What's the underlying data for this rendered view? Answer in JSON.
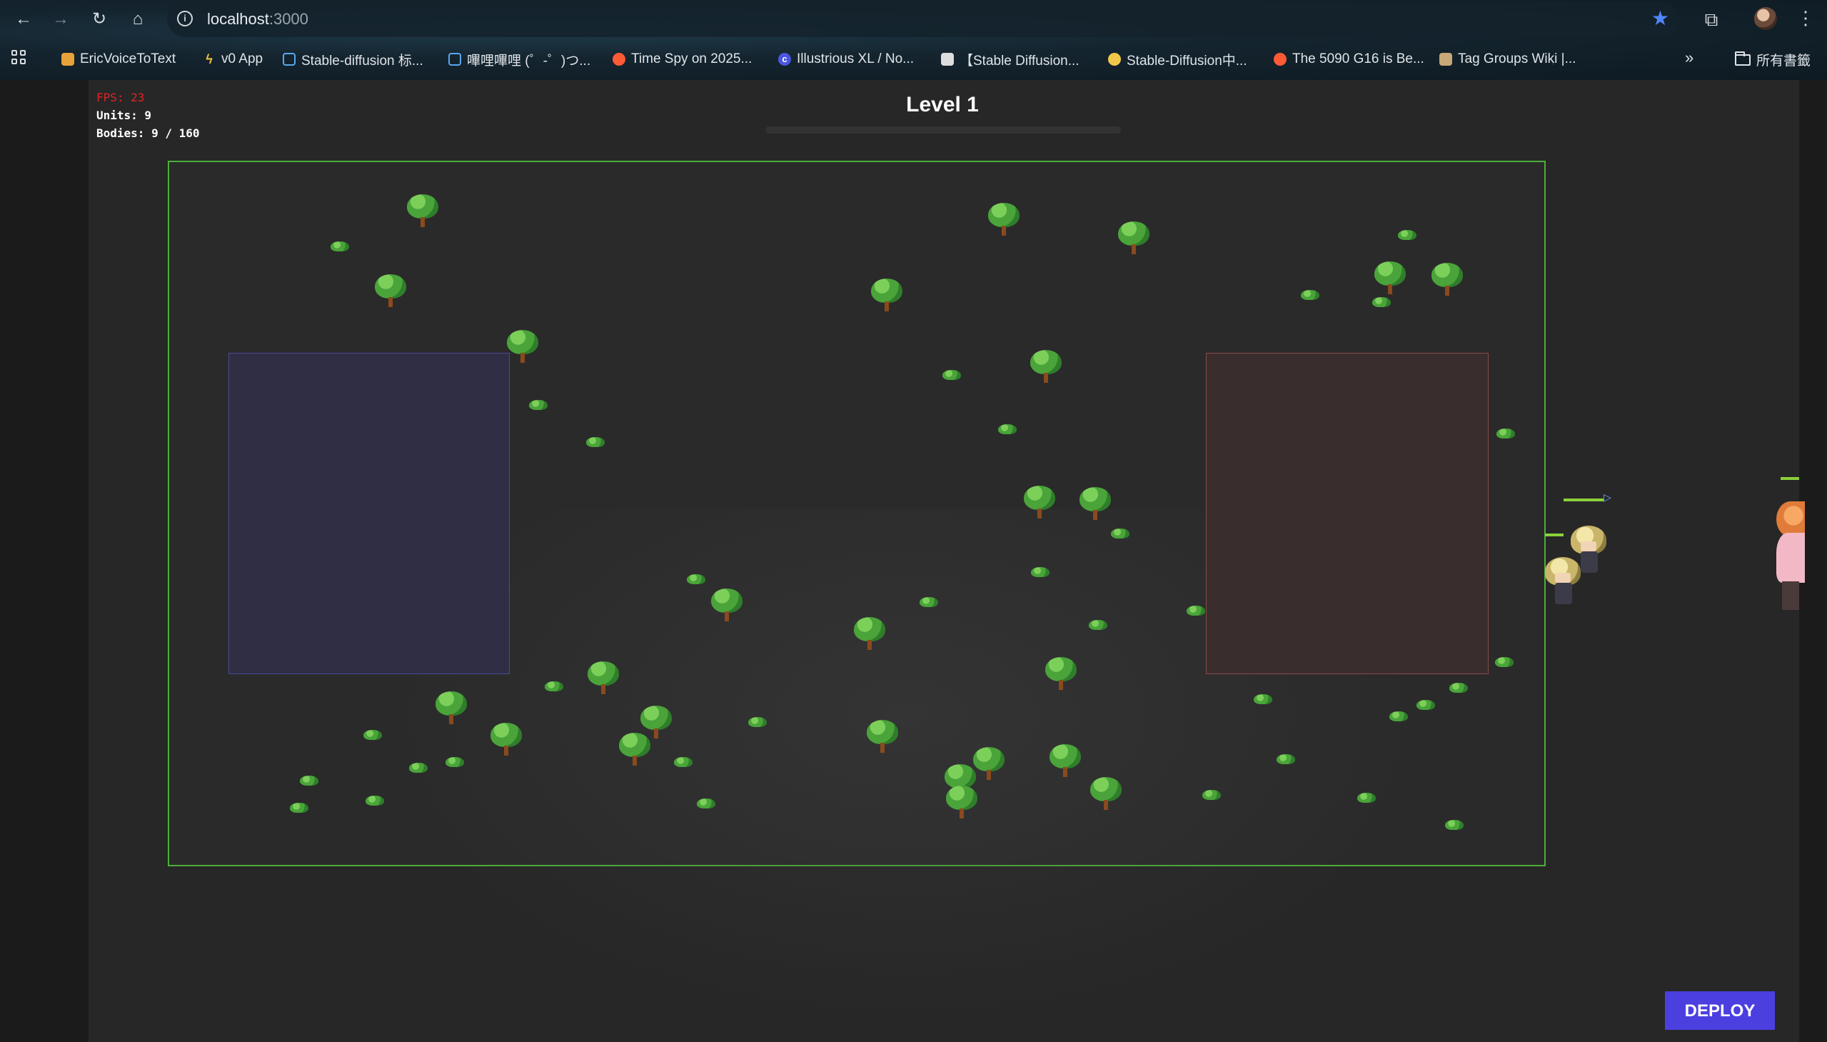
{
  "browser": {
    "url_host": "localhost",
    "url_port": ":3000",
    "bookmarks": [
      {
        "label": "EricVoiceToText",
        "icon": "layers-icon",
        "color": "#e8a23a"
      },
      {
        "label": "v0 App",
        "icon": "bolt-icon",
        "color": "#f0c040"
      },
      {
        "label": "Stable-diffusion 标...",
        "icon": "bilibili-icon",
        "color": "#5aa7f0"
      },
      {
        "label": "嗶哩嗶哩 (゜-゜)つ...",
        "icon": "bilibili-icon",
        "color": "#5aa7f0"
      },
      {
        "label": "Time Spy on 2025...",
        "icon": "reddit-icon",
        "color": "#ff5a36"
      },
      {
        "label": "Illustrious XL / No...",
        "icon": "civitai-icon",
        "color": "#4a56e0"
      },
      {
        "label": "【Stable Diffusion...",
        "icon": "portrait-icon",
        "color": "#dddddd"
      },
      {
        "label": "Stable-Diffusion中...",
        "icon": "emoji-icon",
        "color": "#f2c84b"
      },
      {
        "label": "The 5090 G16 is Be...",
        "icon": "reddit-icon",
        "color": "#ff5a36"
      },
      {
        "label": "Tag Groups Wiki |...",
        "icon": "book-icon",
        "color": "#c8a878"
      }
    ],
    "all_bookmarks_label": "所有書籤"
  },
  "hud": {
    "fps": "FPS: 23",
    "units": "Units: 9",
    "bodies": "Bodies: 9 / 160"
  },
  "level": {
    "title": "Level 1"
  },
  "deploy_button": "DEPLOY",
  "colors": {
    "field_border": "#4caf3a",
    "blue_zone": "#2f2e44",
    "red_zone": "#3a2d2e",
    "deploy": "#4b3fe0",
    "fps_text": "#e02424"
  }
}
